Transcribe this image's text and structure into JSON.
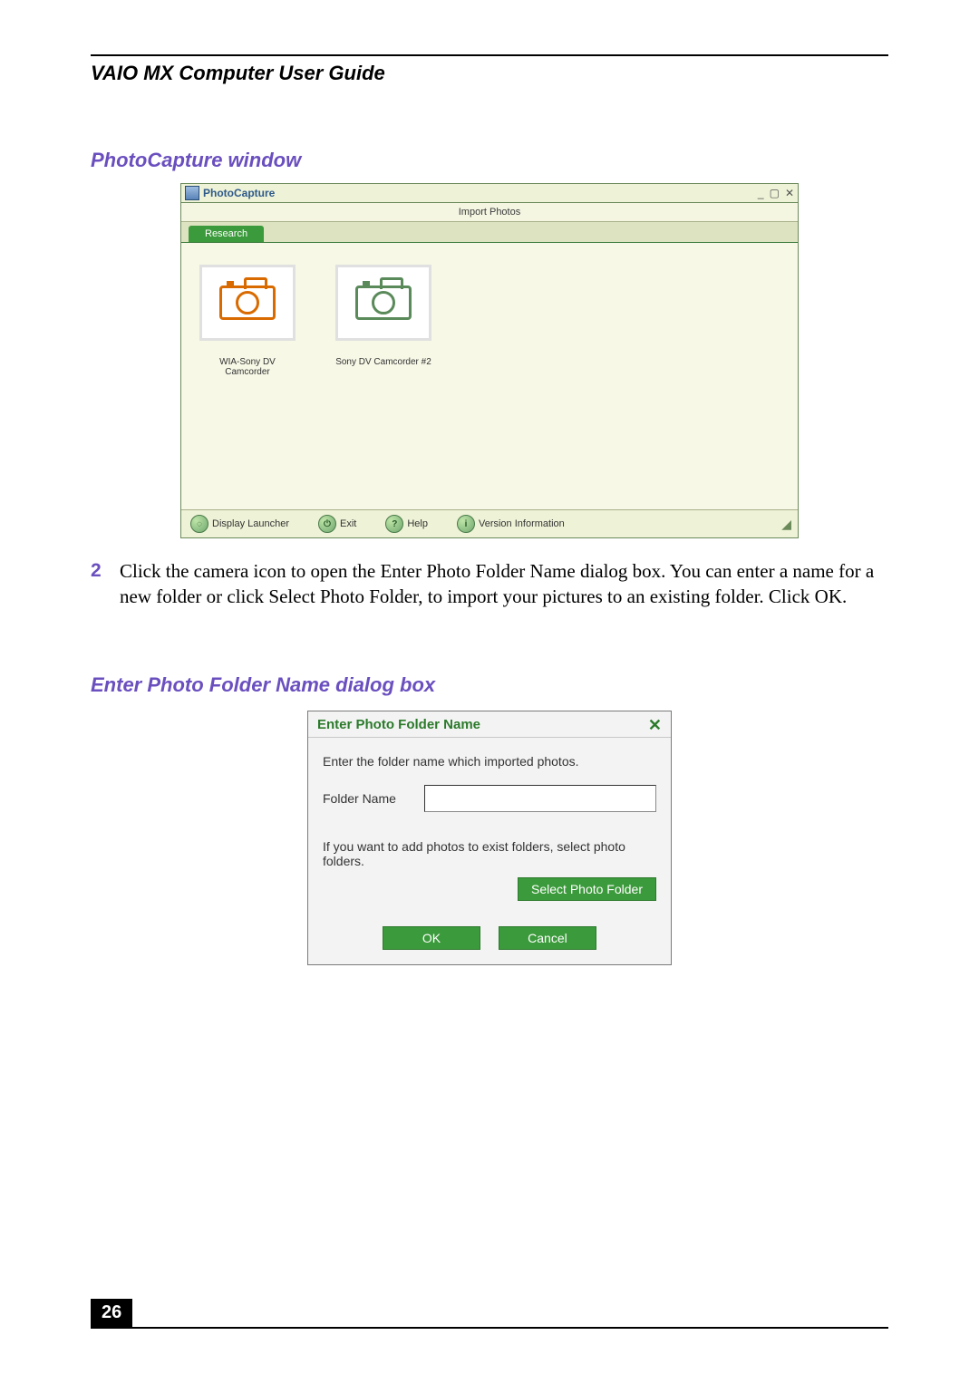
{
  "document": {
    "title": "VAIO MX Computer User Guide",
    "page_number": "26"
  },
  "section1": {
    "heading": "PhotoCapture window",
    "window": {
      "title": "PhotoCapture",
      "sub_header": "Import Photos",
      "tab_label": "Research",
      "devices": [
        {
          "label": "WIA-Sony DV Camcorder",
          "color": "#d96a00"
        },
        {
          "label": "Sony DV Camcorder #2",
          "color": "#5a8a5a"
        }
      ],
      "toolbar": {
        "display_launcher": "Display Launcher",
        "exit": "Exit",
        "help": "Help",
        "version": "Version Information"
      }
    }
  },
  "step2": {
    "number": "2",
    "text": "Click the camera icon to open the Enter Photo Folder Name dialog box. You can enter a name for a new folder or click Select Photo Folder, to import your pictures to an existing folder. Click OK."
  },
  "section2": {
    "heading": "Enter Photo Folder Name dialog box",
    "dialog": {
      "title": "Enter Photo Folder Name",
      "instruction": "Enter the folder name which imported photos.",
      "field_label": "Folder Name",
      "field_value": "",
      "note": "If you want to add photos to exist folders, select photo folders.",
      "select_button": "Select Photo Folder",
      "ok": "OK",
      "cancel": "Cancel"
    }
  }
}
